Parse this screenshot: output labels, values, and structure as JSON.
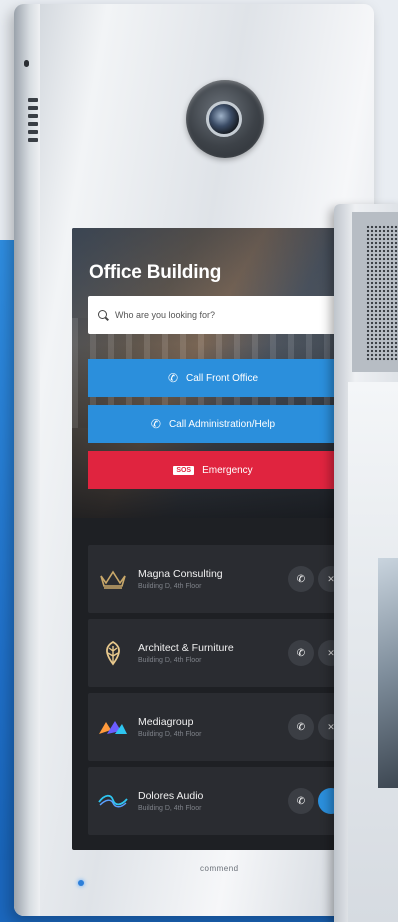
{
  "colors": {
    "accent_blue": "#2b8fdc",
    "emergency_red": "#e0243f",
    "list_bg": "#2a2c31"
  },
  "screen": {
    "title": "Office Building",
    "search": {
      "placeholder": "Who are you looking for?",
      "icon": "search-icon"
    },
    "buttons": {
      "front_office": "Call Front Office",
      "administration": "Call Administration/Help",
      "emergency_badge": "SOS",
      "emergency": "Emergency"
    },
    "contacts": [
      {
        "name": "Magna Consulting",
        "location": "Building D, 4th Floor",
        "logo": "crown-leaf-icon"
      },
      {
        "name": "Architect & Furniture",
        "location": "Building D, 4th Floor",
        "logo": "leaf-icon"
      },
      {
        "name": "Mediagroup",
        "location": "Building D, 4th Floor",
        "logo": "mountains-icon"
      },
      {
        "name": "Dolores Audio",
        "location": "Building D, 4th Floor",
        "logo": "waves-icon"
      }
    ]
  },
  "device": {
    "brand": "commend"
  }
}
